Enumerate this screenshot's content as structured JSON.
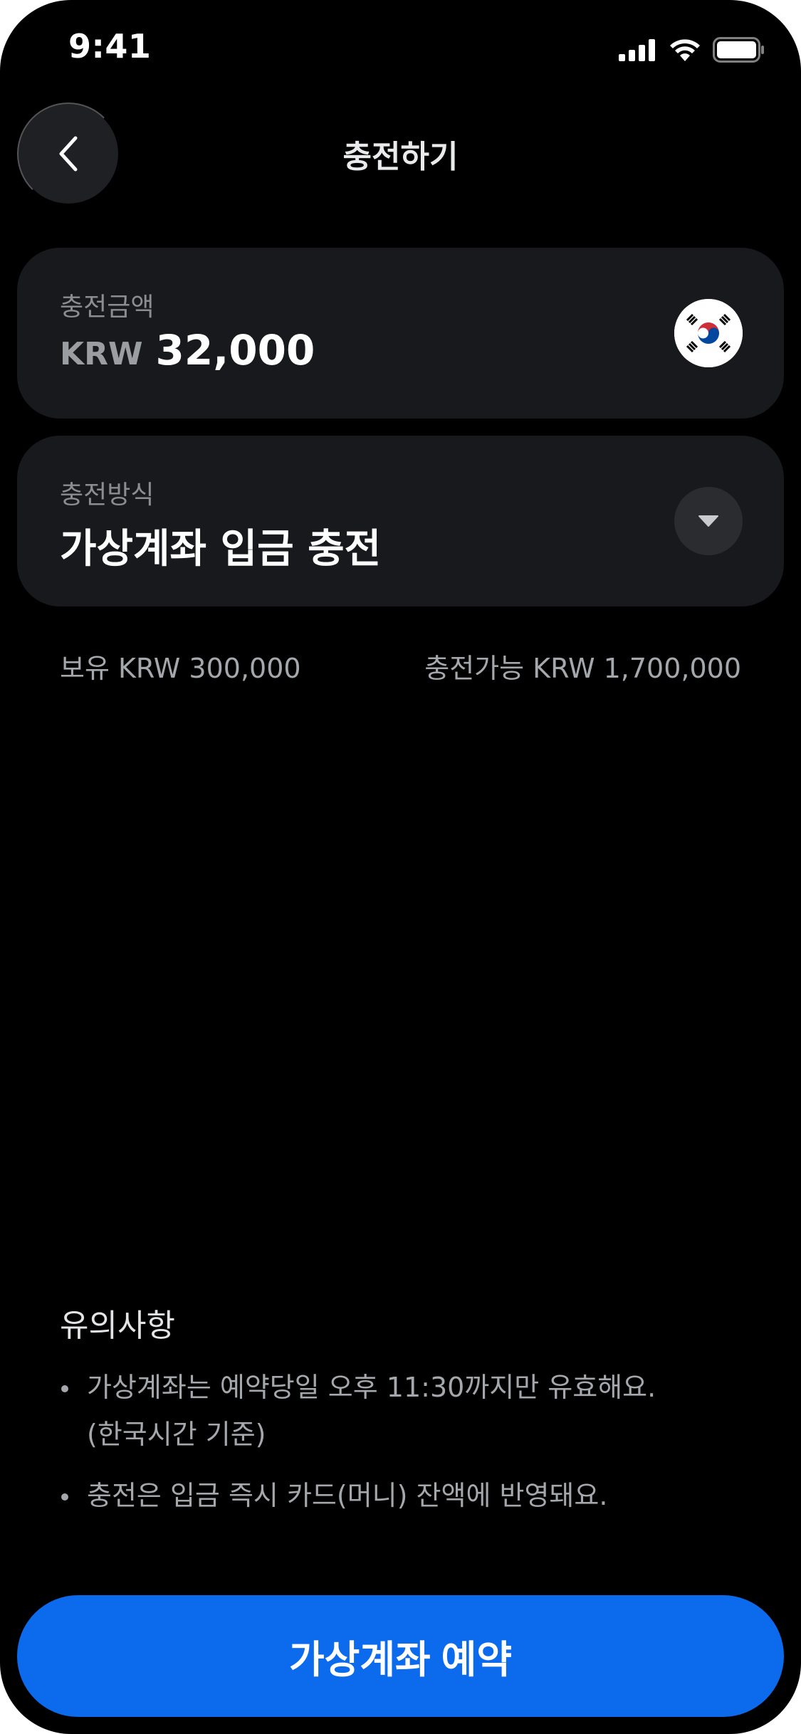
{
  "status_bar": {
    "time": "9:41",
    "icons": [
      "cellular-signal-icon",
      "wifi-icon",
      "battery-icon"
    ]
  },
  "header": {
    "back_icon": "chevron-left-icon",
    "title": "충전하기"
  },
  "amount_card": {
    "label": "충전금액",
    "currency": "KRW",
    "value": "32,000",
    "flag_icon": "south-korea-flag-icon"
  },
  "method_card": {
    "label": "충전방식",
    "value": "가상계좌 입금 충전",
    "dropdown_icon": "caret-down-icon"
  },
  "balances": {
    "held": "보유 KRW 300,000",
    "available": "충전가능 KRW 1,700,000"
  },
  "notice": {
    "title": "유의사항",
    "items": [
      {
        "line1": "가상계좌는 예약당일 오후 11:30까지만 유효해요.",
        "line2": "(한국시간 기준)"
      },
      {
        "line1": "충전은 입금 즉시 카드(머니) 잔액에 반영돼요."
      }
    ]
  },
  "cta": {
    "label": "가상계좌 예약"
  },
  "colors": {
    "background": "#000000",
    "card": "#17191c",
    "accent": "#0b6bec",
    "muted_text": "#a4a7ab"
  }
}
